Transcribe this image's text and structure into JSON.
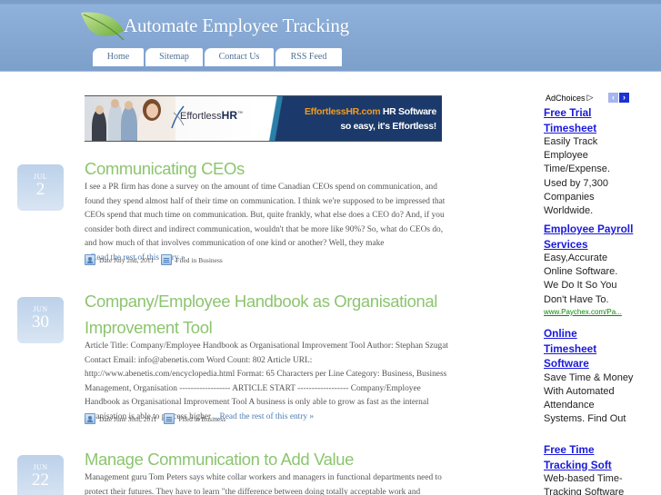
{
  "header": {
    "site_title": "Automate Employee Tracking",
    "nav": [
      {
        "label": "Home"
      },
      {
        "label": "Sitemap"
      },
      {
        "label": "Contact Us"
      },
      {
        "label": "RSS Feed"
      }
    ]
  },
  "banner": {
    "logo_text_light": "Effortless",
    "logo_text_bold": "HR",
    "logo_tm": "™",
    "line1_brand": "EffortlessHR.com",
    "line1_rest": " HR Software",
    "line2": "so easy, it's Effortless!"
  },
  "posts": [
    {
      "month": "JUL",
      "day": "2",
      "title": "Communicating CEOs",
      "body": "I see a PR firm has done a survey on the amount of time Canadian CEOs spend on communication, and found they spend almost half of their time on communication. I think we're supposed to be impressed that CEOs spend that much time on communication. But, quite frankly, what else does a CEO do? And, if you consider both direct and indirect communication, wouldn't that be more like 90%? So, what do CEOs do, and how much of that involves communication of one kind or another? Well, they make",
      "read_more": "...Read the rest of this entry »",
      "date_text": "Date July 2nd, 2011",
      "filed_text": "Filed in Business"
    },
    {
      "month": "JUN",
      "day": "30",
      "title": "Company/Employee Handbook as Organisational Improvement Tool",
      "body": "Article Title: Company/Employee Handbook as Organisational Improvement Tool Author: Stephan Szugat Contact Email: info@abenetis.com Word Count: 802 Article URL: http://www.abenetis.com/encyclopedia.html Format: 65 Characters per Line Category: Business, Business Management, Organisation ------------------ ARTICLE START ------------------ Company/Employee Handbook as Organisational Improvement Tool A business is only able to grow as fast as the internal organisation is able to process higher ",
      "read_more": "...Read the rest of this entry »",
      "date_text": "Date June 30th, 2011",
      "filed_text": "Filed in Business"
    },
    {
      "month": "JUN",
      "day": "22",
      "title": "Manage Communication to Add Value",
      "body": "Management guru Tom Peters says white collar workers and managers in functional departments need to protect their futures. They have to learn \"the difference between doing totally acceptable work and",
      "read_more": "",
      "date_text": "",
      "filed_text": ""
    }
  ],
  "sidebar": {
    "adchoices_label": "AdChoices",
    "adchoices_icon": "▷",
    "prev_icon": "‹",
    "next_icon": "›",
    "ads": [
      {
        "title": "Free Trial Timesheet",
        "text": "Easily Track Employee Time/Expense. Used by 7,300 Companies Worldwide.",
        "url": ""
      },
      {
        "title": "Employee Payroll Services",
        "text": "Easy,Accurate Online Software. We Do It So You Don't Have To.",
        "url": "www.Paychex.com/Pa..."
      },
      {
        "title": "Online Timesheet Software",
        "text": "Save Time & Money With Automated Attendance Systems. Find Out",
        "url": ""
      },
      {
        "title": "Free Time Tracking Soft",
        "text": "Web-based Time-Tracking Software",
        "url": ""
      }
    ]
  }
}
